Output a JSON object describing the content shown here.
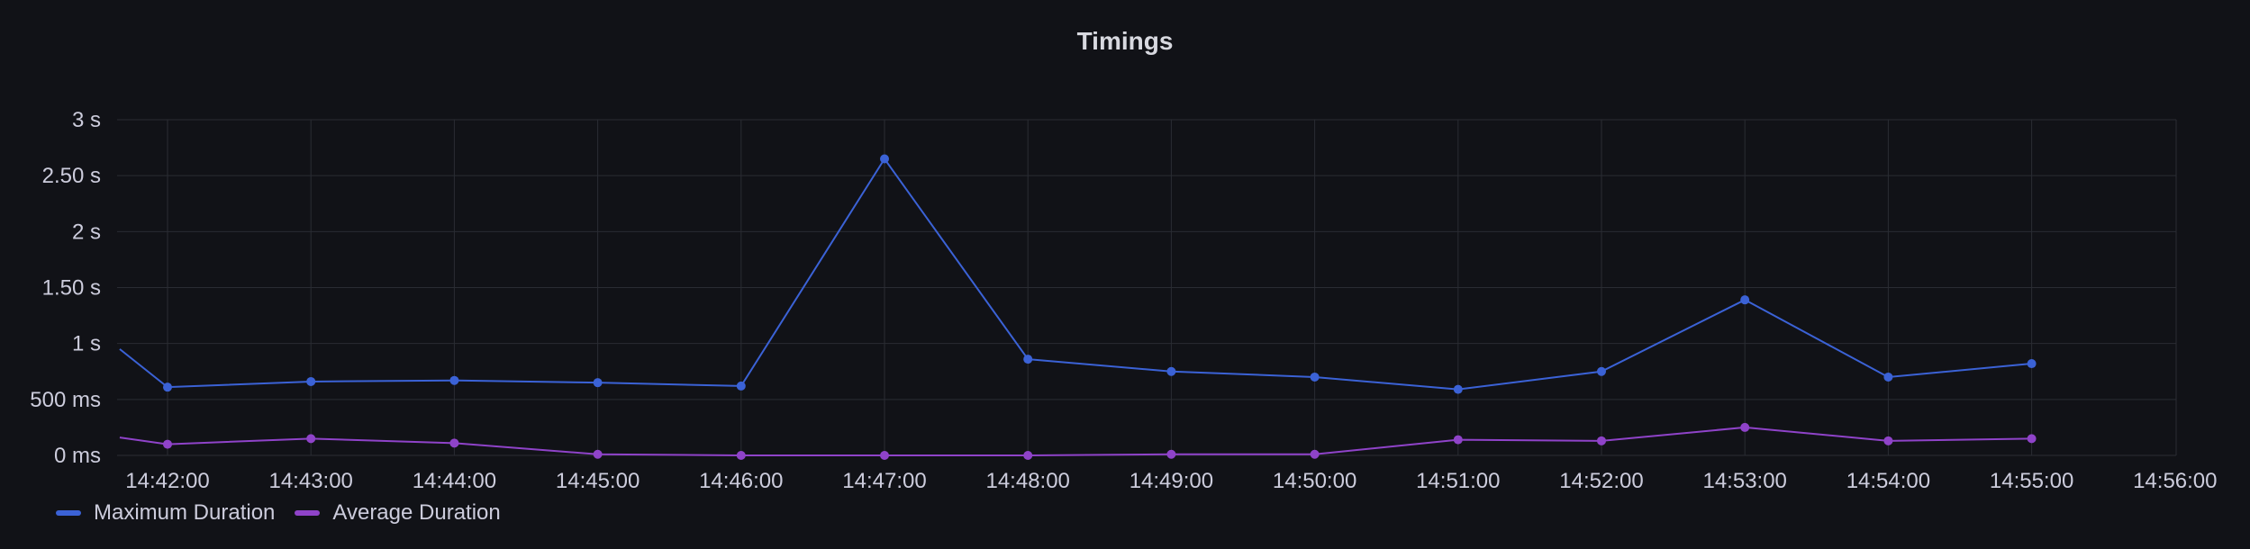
{
  "panel": {
    "title": "Timings"
  },
  "colors": {
    "max": "#3b62d6",
    "avg": "#8f43c9",
    "grid": "#2a2c33"
  },
  "legend": [
    {
      "label": "Maximum Duration",
      "color": "#3b62d6"
    },
    {
      "label": "Average Duration",
      "color": "#8f43c9"
    }
  ],
  "chart_data": {
    "type": "line",
    "title": "Timings",
    "x_tick_labels": [
      "14:42:00",
      "14:43:00",
      "14:44:00",
      "14:45:00",
      "14:46:00",
      "14:47:00",
      "14:48:00",
      "14:49:00",
      "14:50:00",
      "14:51:00",
      "14:52:00",
      "14:53:00",
      "14:54:00",
      "14:55:00",
      "14:56:00"
    ],
    "y_tick_labels": [
      "0 ms",
      "500 ms",
      "1 s",
      "1.50 s",
      "2 s",
      "2.50 s",
      "3 s"
    ],
    "ylim": [
      0,
      3
    ],
    "y_unit": "s",
    "grid": true,
    "legend_position": "bottom-left",
    "series": [
      {
        "name": "Maximum Duration",
        "color": "#3b62d6",
        "points": [
          {
            "x": "14:41:40",
            "y": 0.95
          },
          {
            "x": "14:42:00",
            "y": 0.61
          },
          {
            "x": "14:43:00",
            "y": 0.66
          },
          {
            "x": "14:44:00",
            "y": 0.67
          },
          {
            "x": "14:45:00",
            "y": 0.65
          },
          {
            "x": "14:46:00",
            "y": 0.62
          },
          {
            "x": "14:47:00",
            "y": 2.65
          },
          {
            "x": "14:48:00",
            "y": 0.86
          },
          {
            "x": "14:49:00",
            "y": 0.75
          },
          {
            "x": "14:50:00",
            "y": 0.7
          },
          {
            "x": "14:51:00",
            "y": 0.59
          },
          {
            "x": "14:52:00",
            "y": 0.75
          },
          {
            "x": "14:53:00",
            "y": 1.39
          },
          {
            "x": "14:54:00",
            "y": 0.7
          },
          {
            "x": "14:55:00",
            "y": 0.82
          }
        ]
      },
      {
        "name": "Average Duration",
        "color": "#8f43c9",
        "points": [
          {
            "x": "14:41:40",
            "y": 0.16
          },
          {
            "x": "14:42:00",
            "y": 0.1
          },
          {
            "x": "14:43:00",
            "y": 0.15
          },
          {
            "x": "14:44:00",
            "y": 0.11
          },
          {
            "x": "14:45:00",
            "y": 0.01
          },
          {
            "x": "14:46:00",
            "y": 0.0
          },
          {
            "x": "14:47:00",
            "y": 0.0
          },
          {
            "x": "14:48:00",
            "y": 0.0
          },
          {
            "x": "14:49:00",
            "y": 0.01
          },
          {
            "x": "14:50:00",
            "y": 0.01
          },
          {
            "x": "14:51:00",
            "y": 0.14
          },
          {
            "x": "14:52:00",
            "y": 0.13
          },
          {
            "x": "14:53:00",
            "y": 0.25
          },
          {
            "x": "14:54:00",
            "y": 0.13
          },
          {
            "x": "14:55:00",
            "y": 0.15
          }
        ]
      }
    ]
  }
}
